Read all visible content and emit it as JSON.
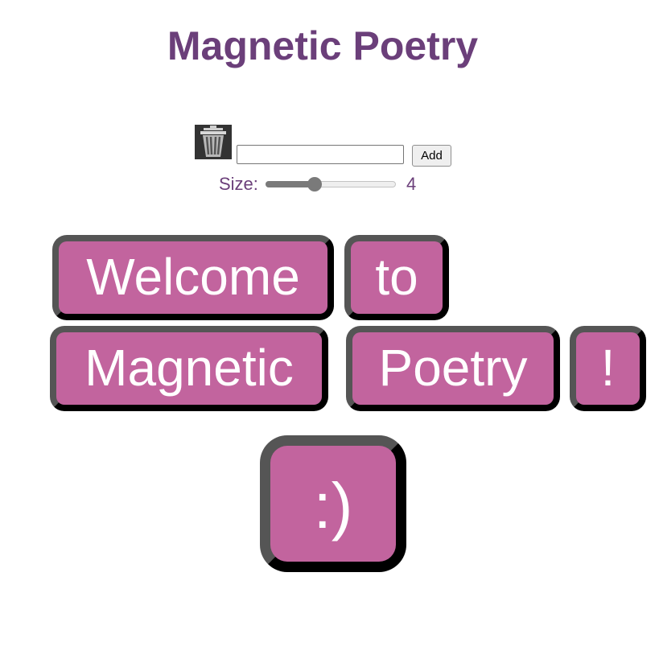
{
  "header": {
    "title": "Magnetic Poetry"
  },
  "toolbar": {
    "trash_icon": "trash-can-icon",
    "input_value": "",
    "input_placeholder": "",
    "add_label": "Add",
    "size_label": "Size:",
    "size_value": "4",
    "size_fraction": 0.36
  },
  "magnets": [
    {
      "text": "Welcome"
    },
    {
      "text": "to"
    },
    {
      "text": "Magnetic"
    },
    {
      "text": "Poetry"
    },
    {
      "text": "!"
    },
    {
      "text": ":)"
    }
  ],
  "colors": {
    "title": "#6b3f7a",
    "magnet_fill": "#c2649e",
    "magnet_border_dark": "#000000",
    "magnet_border_light": "#555555",
    "magnet_text": "#ffffff"
  }
}
